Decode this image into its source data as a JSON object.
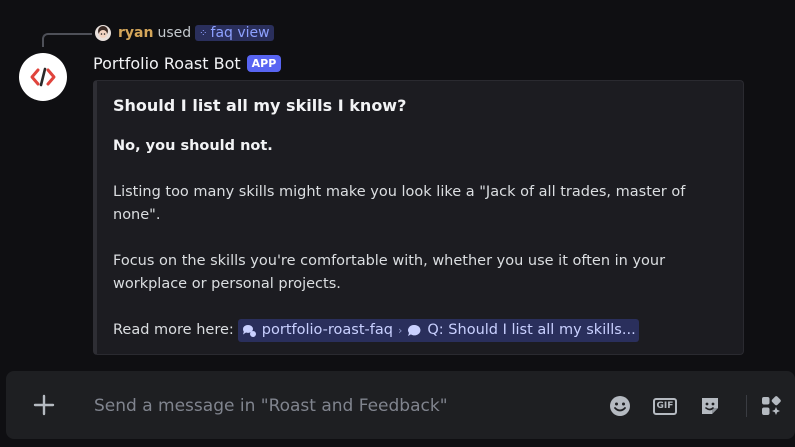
{
  "reply": {
    "username": "ryan",
    "action": "used",
    "command": "faq view"
  },
  "message": {
    "author": "Portfolio Roast Bot",
    "badge": "APP"
  },
  "embed": {
    "title": "Should I list all my skills I know?",
    "answer": "No, you should not.",
    "paragraph1": "Listing too many skills might make you look like a \"Jack of all trades, master of none\".",
    "paragraph2": "Focus on the skills you're comfortable with, whether you use it often in your workplace or personal projects.",
    "read_more_label": "Read more here:",
    "channel_mention": "portfolio-roast-faq",
    "thread_mention": "Q: Should I list all my skills..."
  },
  "composer": {
    "placeholder": "Send a message in \"Roast and Feedback\""
  },
  "colors": {
    "accent": "#5865f2",
    "username": "#d4a65a",
    "bot_logo_red": "#e0443c"
  }
}
